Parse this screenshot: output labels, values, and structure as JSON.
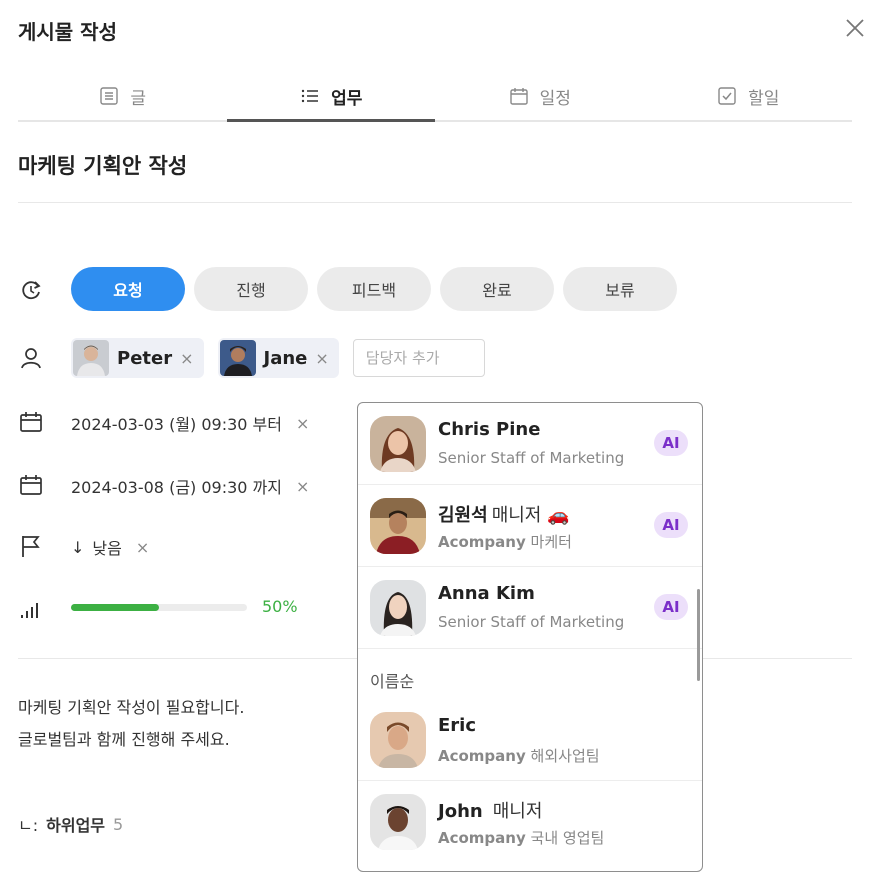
{
  "header": {
    "title": "게시물 작성"
  },
  "tabs": [
    {
      "label": "글",
      "icon": "document-icon"
    },
    {
      "label": "업무",
      "icon": "list-icon"
    },
    {
      "label": "일정",
      "icon": "calendar-icon"
    },
    {
      "label": "할일",
      "icon": "checkbox-icon"
    }
  ],
  "active_tab": "업무",
  "post": {
    "title": "마케팅 기획안 작성"
  },
  "status": {
    "options": [
      "요청",
      "진행",
      "피드백",
      "완료",
      "보류"
    ],
    "selected": "요청",
    "colors": {
      "active": "#2f8ef0",
      "inactive": "#ebebeb"
    }
  },
  "assignees": {
    "people": [
      {
        "name": "Peter"
      },
      {
        "name": "Jane"
      }
    ],
    "remove_glyph": "×",
    "add_placeholder": "담당자 추가"
  },
  "dates": {
    "start": "2024-03-03 (월) 09:30 부터",
    "end": "2024-03-08 (금) 09:30 까지"
  },
  "priority": {
    "label": "낮음",
    "arrow": "↓"
  },
  "progress": {
    "percent": 50,
    "label": "50%",
    "color": "#3cb043"
  },
  "description": {
    "line1": "마케팅 기획안 작성이 필요합니다.",
    "line2": "글로벌팀과 함께 진행해 주세요."
  },
  "subtasks": {
    "glyph": "ㄴ:",
    "label": "하위업무",
    "count": "5"
  },
  "dropdown": {
    "items": [
      {
        "name": "Chris Pine",
        "suffix": "",
        "company": "",
        "subtitle": "Senior Staff of Marketing",
        "badge": "AI"
      },
      {
        "name": "김원석",
        "suffix": "매니저 🚗",
        "company": "Acompany",
        "subtitle": "마케터",
        "badge": "AI"
      },
      {
        "name": "Anna Kim",
        "suffix": "",
        "company": "",
        "subtitle": "Senior Staff of Marketing",
        "badge": "AI"
      }
    ],
    "section_label": "이름순",
    "sorted_items": [
      {
        "name": "Eric",
        "suffix": "",
        "company": "Acompany",
        "subtitle": "해외사업팀"
      },
      {
        "name": "John",
        "suffix": "매니저",
        "company": "Acompany",
        "subtitle": "국내 영업팀"
      }
    ],
    "badge_color": "#7b2fc9"
  }
}
